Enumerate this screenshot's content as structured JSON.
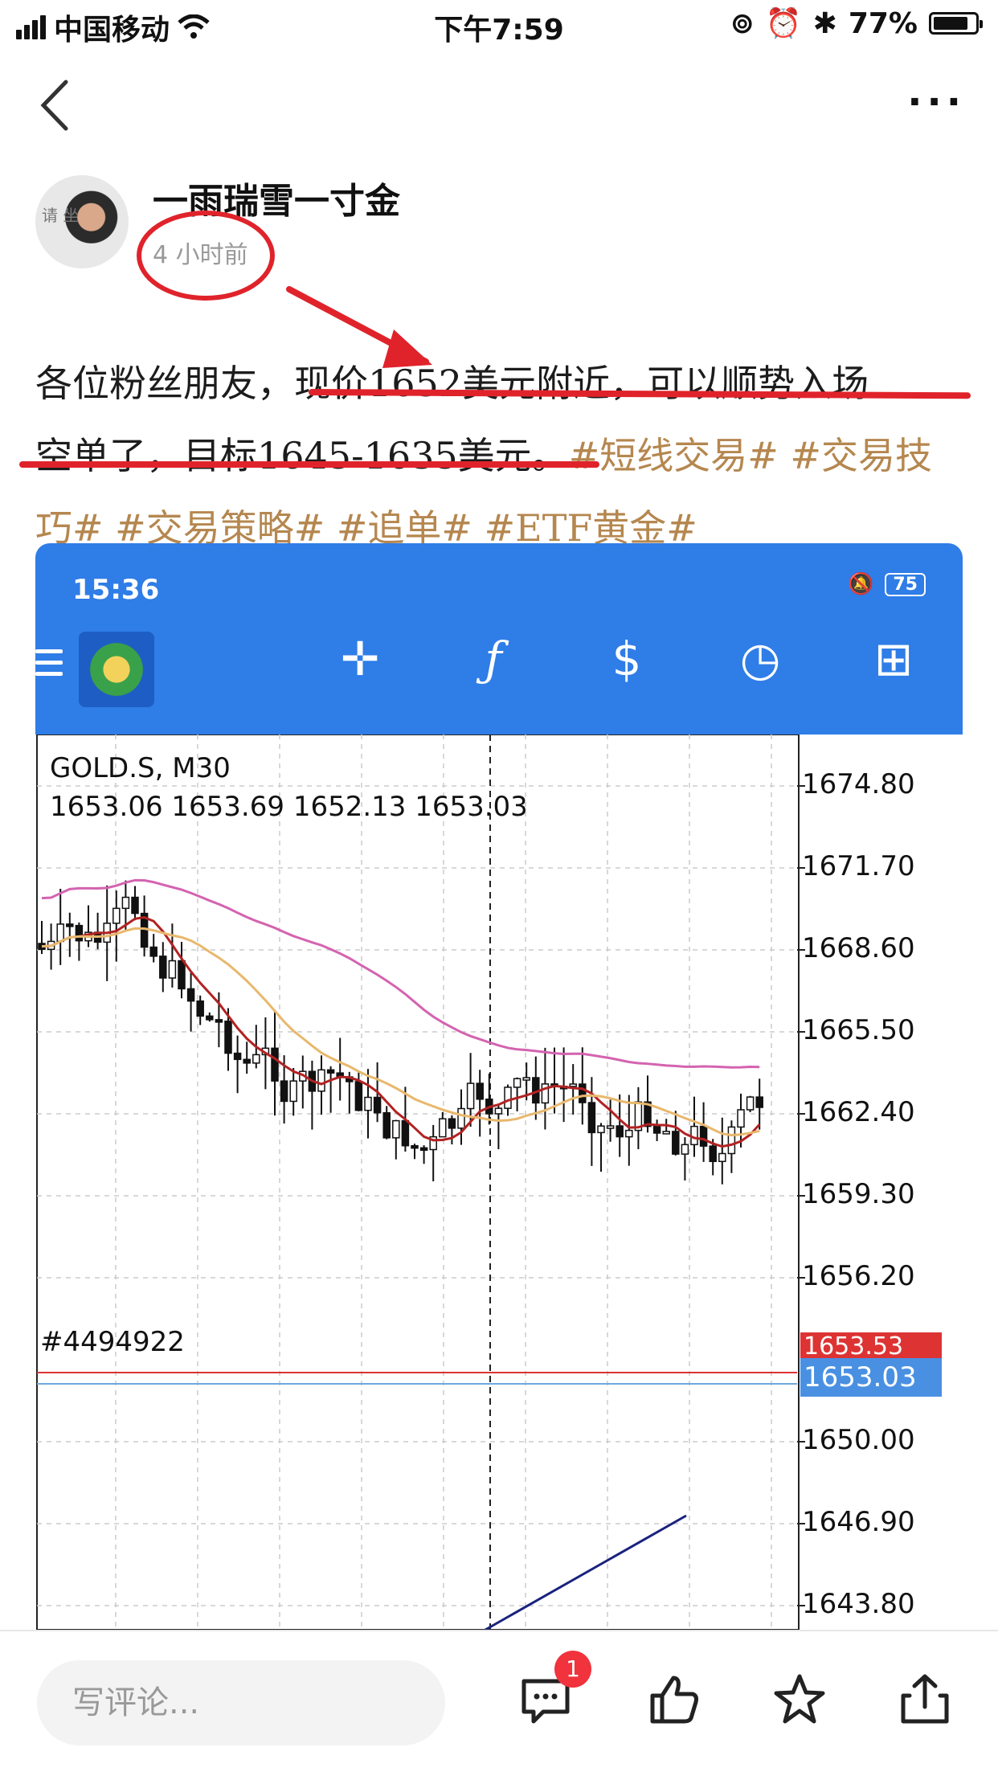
{
  "status_bar": {
    "carrier": "中国移动",
    "time": "下午7:59",
    "battery_percent": "77%",
    "battery_level": 0.77
  },
  "nav": {
    "back_icon": "chevron-left-icon",
    "more_label": "···"
  },
  "author": {
    "name": "一雨瑞雪一寸金",
    "posted": "4 小时前",
    "avatar_text": "请 坐"
  },
  "post": {
    "line1a": "各位粉丝朋友，",
    "line1b": "现价1652美元附近，可以顺势入场",
    "line2a": "空单了，目标1645-1635美元。",
    "tags1": "#短线交易# #交易技",
    "tags2": "巧# #交易策略# #追单# #ETF黄金#"
  },
  "screenshot": {
    "status_time": "15:36",
    "battery": "75",
    "toolbar": [
      "crosshair-icon",
      "function-icon",
      "trade-icon",
      "clock-icon",
      "new-order-icon"
    ],
    "symbol": "GOLD.S, M30",
    "ohlc": "1653.06 1653.69 1652.13 1653.03",
    "ticket": "#4494922",
    "price_levels": [
      "1674.80",
      "1671.70",
      "1668.60",
      "1665.50",
      "1662.40",
      "1659.30",
      "1656.20",
      "1653.03",
      "1650.00",
      "1646.90",
      "1643.80"
    ],
    "current_price": "1653.03",
    "order_price": "1653.53"
  },
  "bottom_bar": {
    "comment_placeholder": "写评论...",
    "comment_badge": "1",
    "accent": "#f0333c"
  },
  "colors": {
    "tag": "#b5874f",
    "annotation_red": "#e0232b",
    "mt_blue": "#2f7de7"
  }
}
